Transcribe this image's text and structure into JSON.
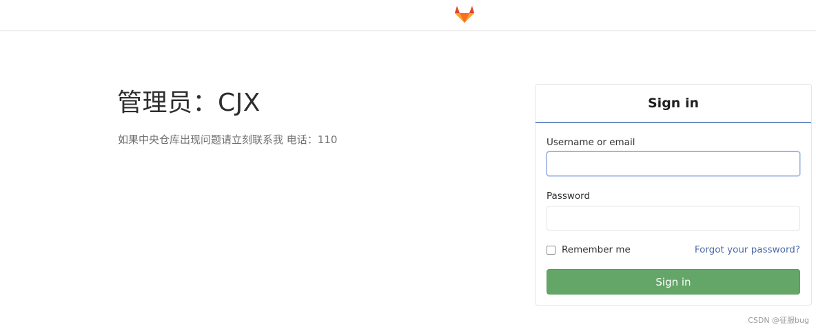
{
  "header": {
    "logo_icon": "gitlab-fox-icon"
  },
  "brand": {
    "title": "管理员：CJX",
    "description": "如果中央仓库出现问题请立刻联系我 电话：110"
  },
  "login": {
    "tab_label": "Sign in",
    "username_label": "Username or email",
    "username_value": "",
    "password_label": "Password",
    "password_value": "",
    "remember_label": "Remember me",
    "remember_checked": false,
    "forgot_link": "Forgot your password?",
    "submit_label": "Sign in"
  },
  "colors": {
    "accent_tab": "#6b8fc9",
    "submit_green": "#64a568",
    "link_blue": "#4a6aa8"
  },
  "watermark": "CSDN @征服bug"
}
